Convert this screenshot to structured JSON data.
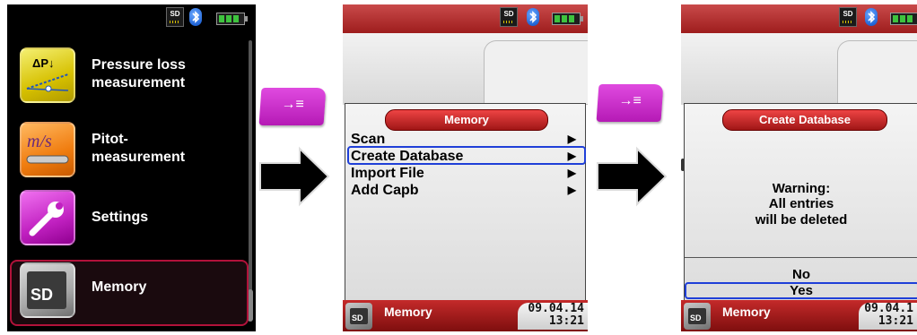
{
  "screen1": {
    "status": {
      "sd_label": "SD"
    },
    "menu": [
      {
        "label_line1": "Pressure loss",
        "label_line2": "measurement",
        "tile_text": "ΔP↓",
        "icon": "pressure-gauge-icon"
      },
      {
        "label_line1": "Pitot-",
        "label_line2": "measurement",
        "tile_text": "m/s",
        "icon": "pitot-tube-icon"
      },
      {
        "label_line1": "Settings",
        "label_line2": "",
        "tile_text": "",
        "icon": "wrench-icon"
      },
      {
        "label_line1": "Memory",
        "label_line2": "",
        "tile_text": "SD",
        "icon": "sd-card-icon"
      }
    ]
  },
  "action_key": {
    "glyph": "→≡"
  },
  "screen2": {
    "status": {
      "sd_label": "SD"
    },
    "title": "Memory",
    "items": [
      "Scan",
      "Create Database",
      "Import File",
      "Add Capb"
    ],
    "selected_index": 1,
    "footer": {
      "label": "Memory",
      "date": "09.04.14",
      "time": "13:21"
    }
  },
  "screen3": {
    "status": {
      "sd_label": "SD"
    },
    "title": "Create Database",
    "warning": [
      "Warning:",
      "All entries",
      "will be deleted"
    ],
    "options": [
      "No",
      "Yes"
    ],
    "selected_option": 1,
    "footer": {
      "label": "Memory",
      "date": "09.04.1",
      "time": "13:21"
    }
  },
  "colors": {
    "accent_red": "#b1123a",
    "action_magenta": "#c828c8",
    "selection_blue": "#1f3fd8",
    "battery_green": "#3ec33e"
  }
}
